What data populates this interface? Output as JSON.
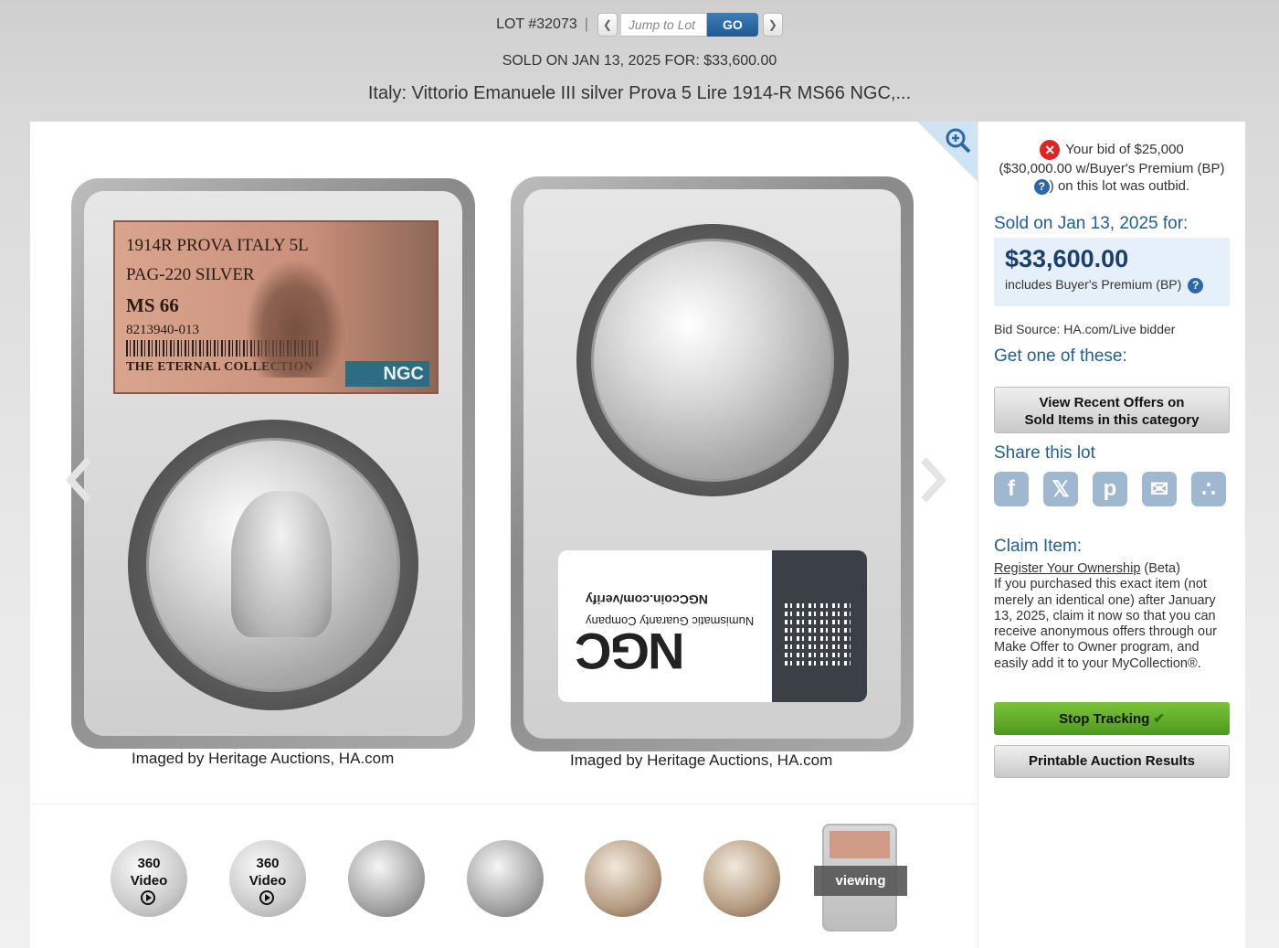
{
  "nav": {
    "lot_label": "LOT #32073",
    "separator": "|",
    "jump_placeholder": "Jump to Lot",
    "go_label": "GO",
    "prev_icon": "chevron-left-icon",
    "next_icon": "chevron-right-icon"
  },
  "sold_line": "SOLD ON JAN 13, 2025 FOR: $33,600.00",
  "title": "Italy: Vittorio Emanuele III silver Prova 5 Lire 1914-R MS66 NGC,...",
  "gallery": {
    "slab_label": {
      "line1": "1914R PROVA ITALY 5L",
      "line2": "PAG-220 SILVER",
      "grade": "MS 66",
      "cert": "8213940-013",
      "collection": "THE ETERNAL COLLECTION",
      "brand": "NGC"
    },
    "reverse_label": {
      "brand": "NGC",
      "company": "Numismatic Guaranty Company",
      "verify": "NGCcoin.com/verify"
    },
    "captions": [
      "Imaged by Heritage Auctions, HA.com",
      "Imaged by Heritage Auctions, HA.com"
    ],
    "thumbnails": [
      {
        "label1": "360",
        "label2": "Video",
        "style": "silver"
      },
      {
        "label1": "360",
        "label2": "Video",
        "style": "silver"
      },
      {
        "style": "gray"
      },
      {
        "style": "gray"
      },
      {
        "style": "toned"
      },
      {
        "style": "toned"
      }
    ],
    "viewing_label": "viewing"
  },
  "sidebar": {
    "outbid_line1": "Your bid of $25,000",
    "outbid_line2": "($30,000.00 w/Buyer's Premium (BP)",
    "outbid_line3": ") on this lot was outbid.",
    "sold_heading": "Sold on Jan 13, 2025 for:",
    "price": "$33,600.00",
    "bp_note": "includes Buyer's Premium (BP)",
    "bid_source": "Bid Source: HA.com/Live bidder",
    "get_heading": "Get one of these:",
    "offers_line1": "View Recent Offers on",
    "offers_line2": "Sold Items in this category",
    "share_heading": "Share this lot",
    "share_icons": [
      "facebook-icon",
      "x-icon",
      "pinterest-icon",
      "email-icon",
      "share-icon"
    ],
    "claim_heading": "Claim Item:",
    "register_link": "Register Your Ownership",
    "beta": " (Beta)",
    "claim_body": "If you purchased this exact item (not merely an identical one) after January 13, 2025, claim it now so that you can receive anonymous offers through our Make Offer to Owner program, and easily add it to your MyCollection®.",
    "stop_tracking": "Stop Tracking",
    "printable": "Printable Auction Results"
  },
  "colors": {
    "accent_blue": "#1f5e96",
    "go_button": "#2b6aa6",
    "stop_green": "#66ae2c",
    "outbid_red": "#e02424"
  }
}
